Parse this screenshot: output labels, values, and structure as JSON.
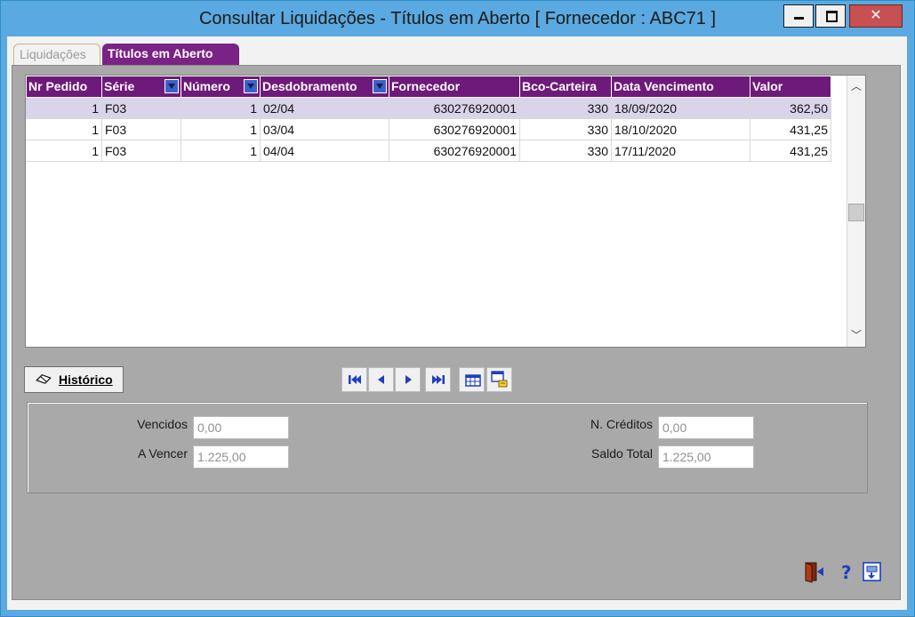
{
  "window": {
    "title": "Consultar Liquidações - Títulos em Aberto [ Fornecedor : ABC71 ]"
  },
  "tabs": [
    {
      "label": "Liquidações",
      "active": false
    },
    {
      "label": "Títulos em Aberto",
      "active": true
    }
  ],
  "grid": {
    "columns": [
      "Nr Pedido",
      "Série",
      "Número",
      "Desdobramento",
      "Fornecedor",
      "Bco-Carteira",
      "Data Vencimento",
      "Valor"
    ],
    "rows": [
      [
        "1",
        "F03",
        "1",
        "02/04",
        "630276920001",
        "330",
        "18/09/2020",
        "362,50"
      ],
      [
        "1",
        "F03",
        "1",
        "03/04",
        "630276920001",
        "330",
        "18/10/2020",
        "431,25"
      ],
      [
        "1",
        "F03",
        "1",
        "04/04",
        "630276920001",
        "330",
        "17/11/2020",
        "431,25"
      ]
    ]
  },
  "buttons": {
    "historico": "Histórico"
  },
  "summary": {
    "vencidos_label": "Vencidos",
    "vencidos_value": "0,00",
    "a_vencer_label": "A Vencer",
    "a_vencer_value": "1.225,00",
    "n_creditos_label": "N. Créditos",
    "n_creditos_value": "0,00",
    "saldo_total_label": "Saldo Total",
    "saldo_total_value": "1.225,00"
  },
  "colors": {
    "header": "#6e1a7a",
    "tab_active": "#7b2286",
    "panel": "#a9a9a9",
    "selected_row": "#d9d4ea",
    "nav_icon": "#1f3fbf"
  },
  "icons": [
    "minimize-icon",
    "maximize-icon",
    "close-icon",
    "eraser-icon",
    "first-record-icon",
    "previous-record-icon",
    "next-record-icon",
    "last-record-icon",
    "grid-view-icon",
    "export-icon",
    "exit-door-icon",
    "help-icon",
    "print-icon"
  ]
}
